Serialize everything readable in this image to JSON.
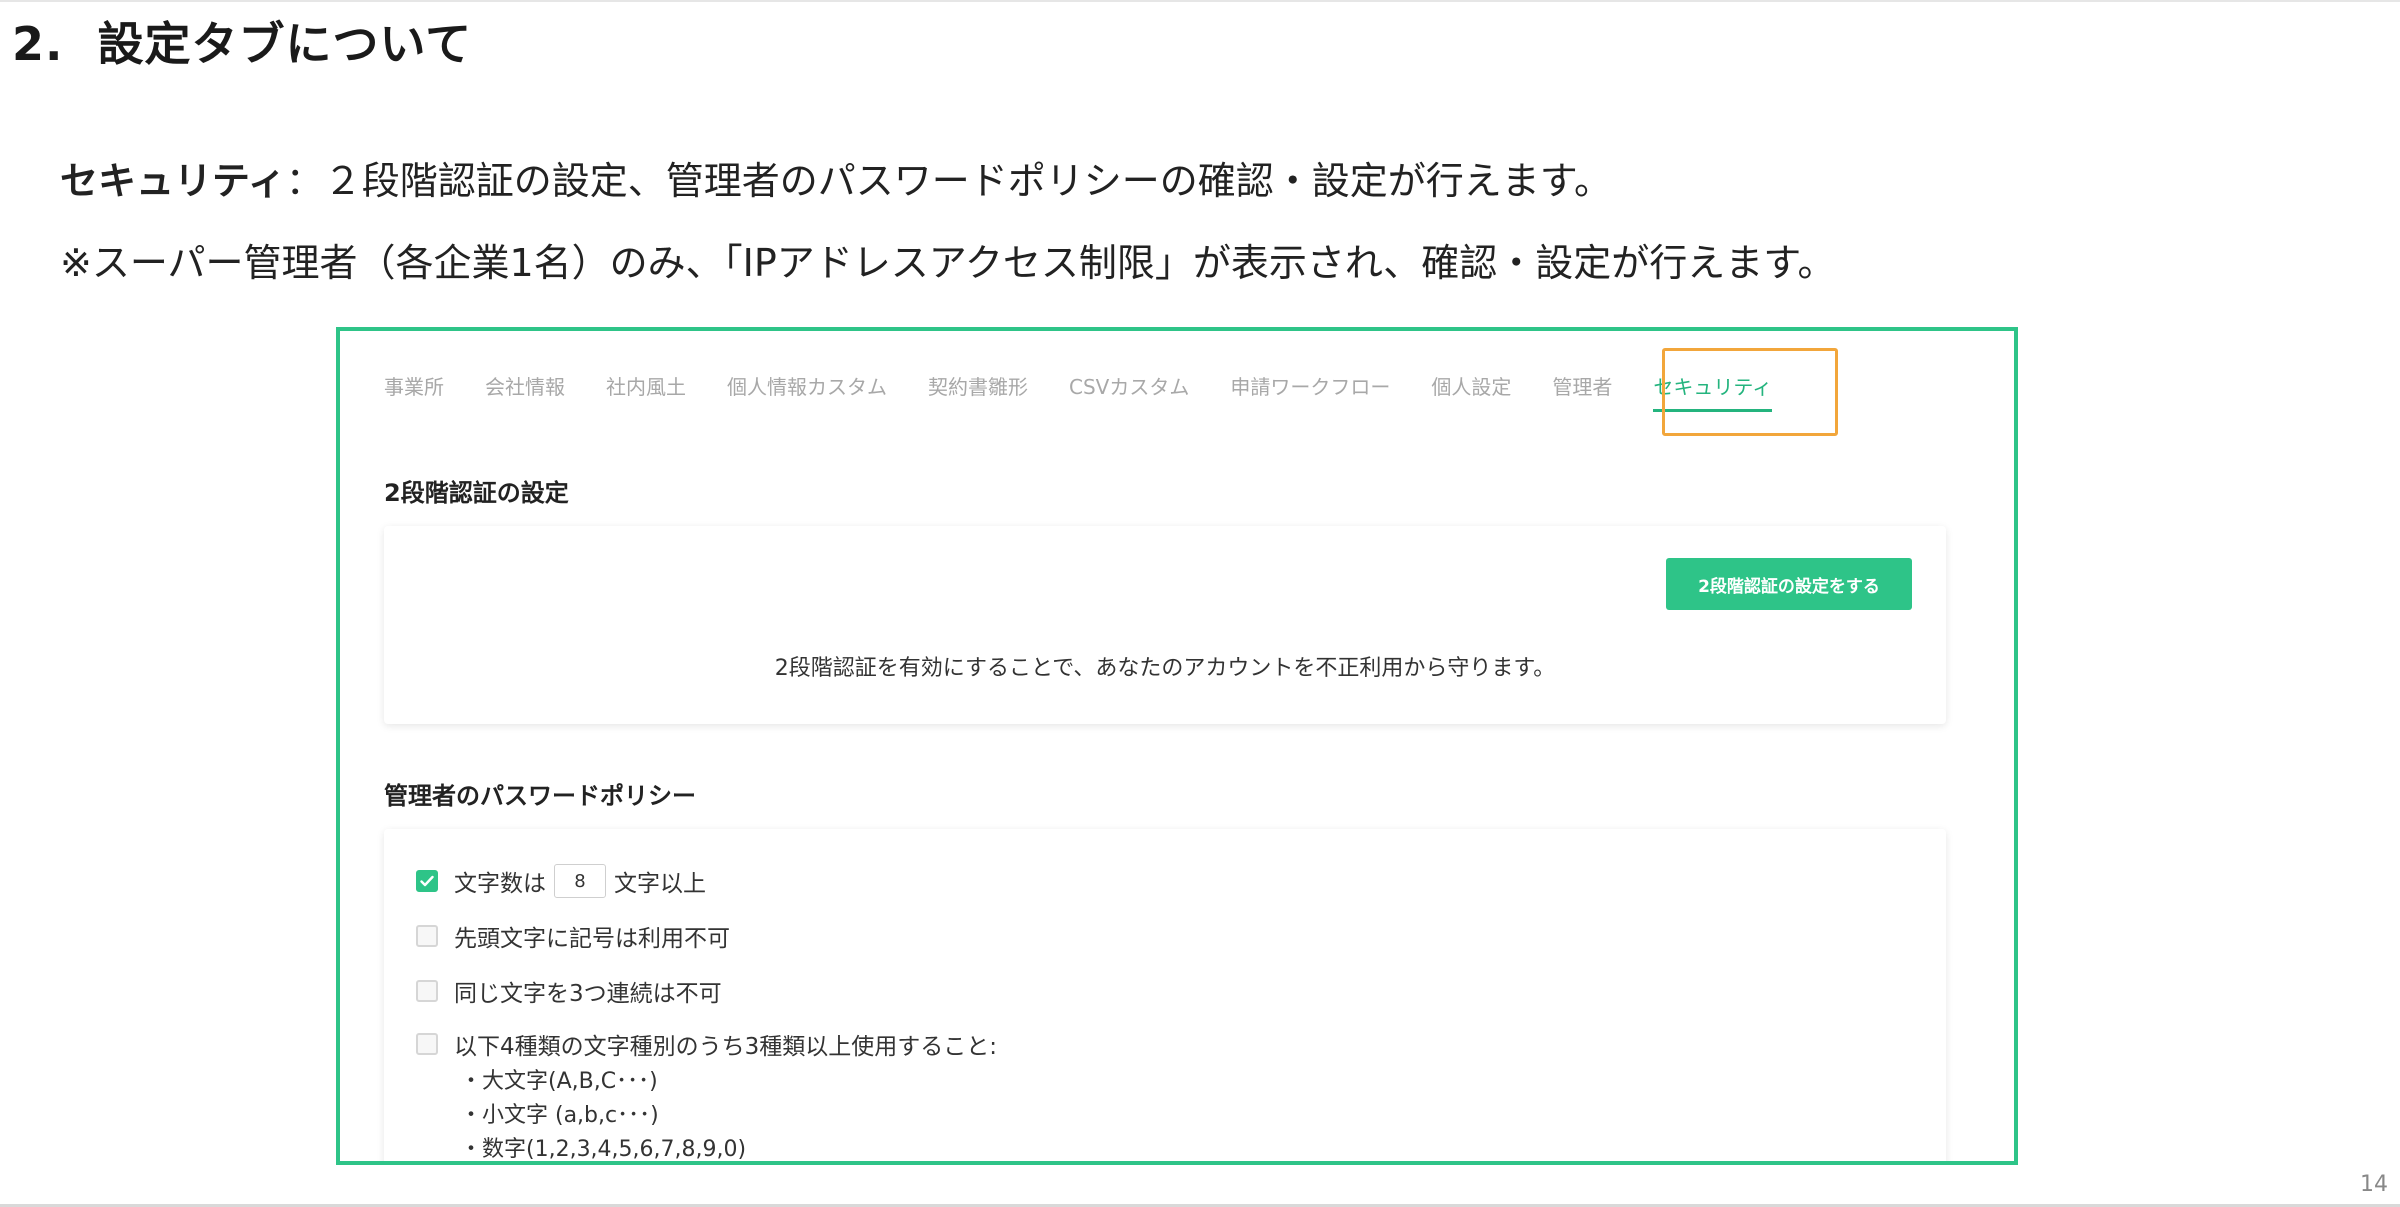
{
  "page": {
    "section_number": "2.",
    "title": "設定タブについて",
    "line1_term": "セキュリティ",
    "line1_text": "：２段階認証の設定、管理者のパスワードポリシーの確認・設定が行えます。",
    "line2_text": "※スーパー管理者（各企業1名）のみ、「IPアドレスアクセス制限」が表示され、確認・設定が行えます。",
    "page_number": "14"
  },
  "screenshot": {
    "tabs": [
      {
        "label": "事業所",
        "active": false
      },
      {
        "label": "会社情報",
        "active": false
      },
      {
        "label": "社内風土",
        "active": false
      },
      {
        "label": "個人情報カスタム",
        "active": false
      },
      {
        "label": "契約書雛形",
        "active": false
      },
      {
        "label": "CSVカスタム",
        "active": false
      },
      {
        "label": "申請ワークフロー",
        "active": false
      },
      {
        "label": "個人設定",
        "active": false
      },
      {
        "label": "管理者",
        "active": false
      },
      {
        "label": "セキュリティ",
        "active": true
      }
    ],
    "two_factor": {
      "title": "2段階認証の設定",
      "button_label": "2段階認証の設定をする",
      "description": "2段階認証を有効にすることで、あなたのアカウントを不正利用から守ります。"
    },
    "password_policy": {
      "title": "管理者のパスワードポリシー",
      "min_length": {
        "checked": true,
        "prefix": "文字数は",
        "value": "8",
        "suffix": "文字以上"
      },
      "no_leading_symbol": {
        "checked": false,
        "label": "先頭文字に記号は利用不可"
      },
      "no_triple_repeat": {
        "checked": false,
        "label": "同じ文字を3つ連続は不可"
      },
      "char_types": {
        "checked": false,
        "label": "以下4種類の文字種別のうち3種類以上使用すること:",
        "items": [
          "・大文字(A,B,C･･･)",
          "・小文字 (a,b,c･･･)",
          "・数字(1,2,3,4,5,6,7,8,9,0)"
        ]
      }
    }
  },
  "colors": {
    "accent_green": "#2ec488",
    "highlight_orange": "#f2a63b",
    "inactive_tab": "#a8a8a8"
  }
}
